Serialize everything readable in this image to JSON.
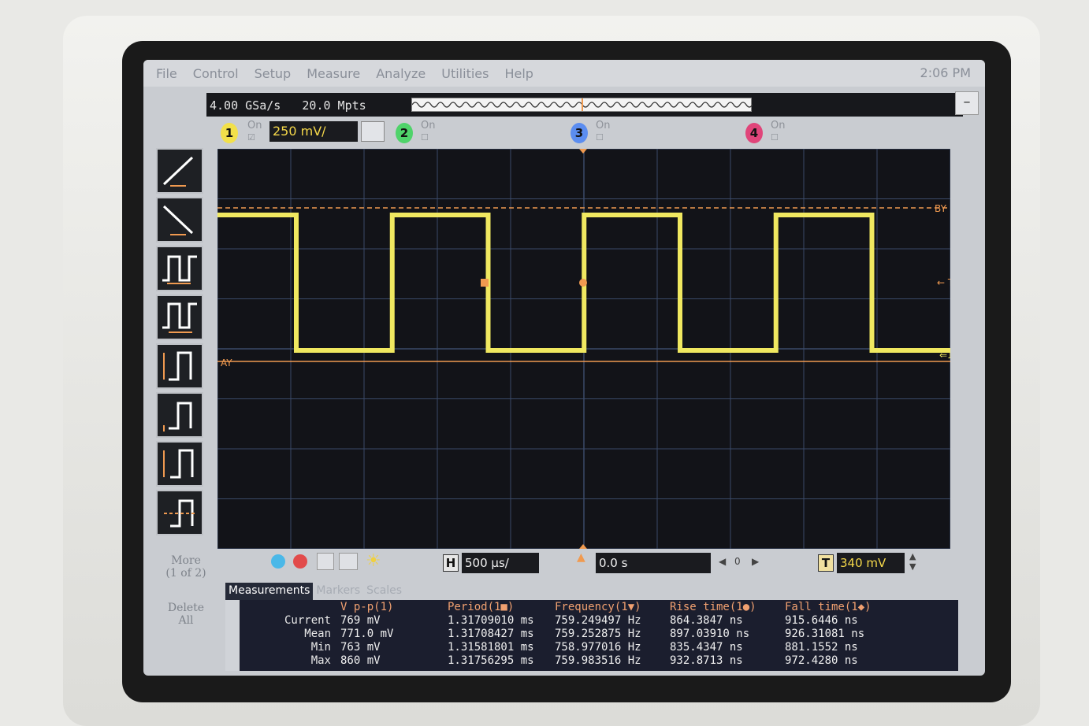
{
  "menu": [
    "File",
    "Control",
    "Setup",
    "Measure",
    "Analyze",
    "Utilities",
    "Help"
  ],
  "clock": "2:06 PM",
  "acquisition": {
    "sample_rate": "4.00 GSa/s",
    "memory": "20.0 Mpts"
  },
  "channels": [
    {
      "num": "1",
      "on_label": "On",
      "enabled": true,
      "color": "#f2e04a"
    },
    {
      "num": "2",
      "on_label": "On",
      "enabled": false,
      "color": "#4fd36a"
    },
    {
      "num": "3",
      "on_label": "On",
      "enabled": false,
      "color": "#5b8df0"
    },
    {
      "num": "4",
      "on_label": "On",
      "enabled": false,
      "color": "#e0457a"
    }
  ],
  "vertical_scale": "250 mV/",
  "markers": {
    "ay_label": "AY",
    "by_label": "BY",
    "trigger_label": "T"
  },
  "sidebar": {
    "more_label": "More",
    "more_page": "(1 of 2)",
    "delete_label": "Delete",
    "delete_sub": "All"
  },
  "horizontal": {
    "h_label": "H",
    "time_scale": "500 µs/",
    "delay": "0.0 s",
    "nav_value": "0"
  },
  "trigger": {
    "t_label": "T",
    "level": "340 mV"
  },
  "tabs": [
    "Measurements",
    "Markers",
    "Scales"
  ],
  "measurements": {
    "headers": [
      "V p-p(1)",
      "Period(1■)",
      "Frequency(1▼)",
      "Rise time(1●)",
      "Fall time(1◆)"
    ],
    "rows": [
      {
        "label": "Current",
        "values": [
          "769 mV",
          "1.31709010 ms",
          "759.249497 Hz",
          "864.3847 ns",
          "915.6446 ns"
        ]
      },
      {
        "label": "Mean",
        "values": [
          "771.0 mV",
          "1.31708427 ms",
          "759.252875 Hz",
          "897.03910 ns",
          "926.31081 ns"
        ]
      },
      {
        "label": "Min",
        "values": [
          "763 mV",
          "1.31581801 ms",
          "758.977016 Hz",
          "835.4347 ns",
          "881.1552 ns"
        ]
      },
      {
        "label": "Max",
        "values": [
          "860 mV",
          "1.31756295 ms",
          "759.983516 Hz",
          "932.8713 ns",
          "972.4280 ns"
        ]
      }
    ]
  },
  "colors": {
    "trace": "#f0e860",
    "marker": "#f09a50",
    "grid": "#3a4a68"
  }
}
